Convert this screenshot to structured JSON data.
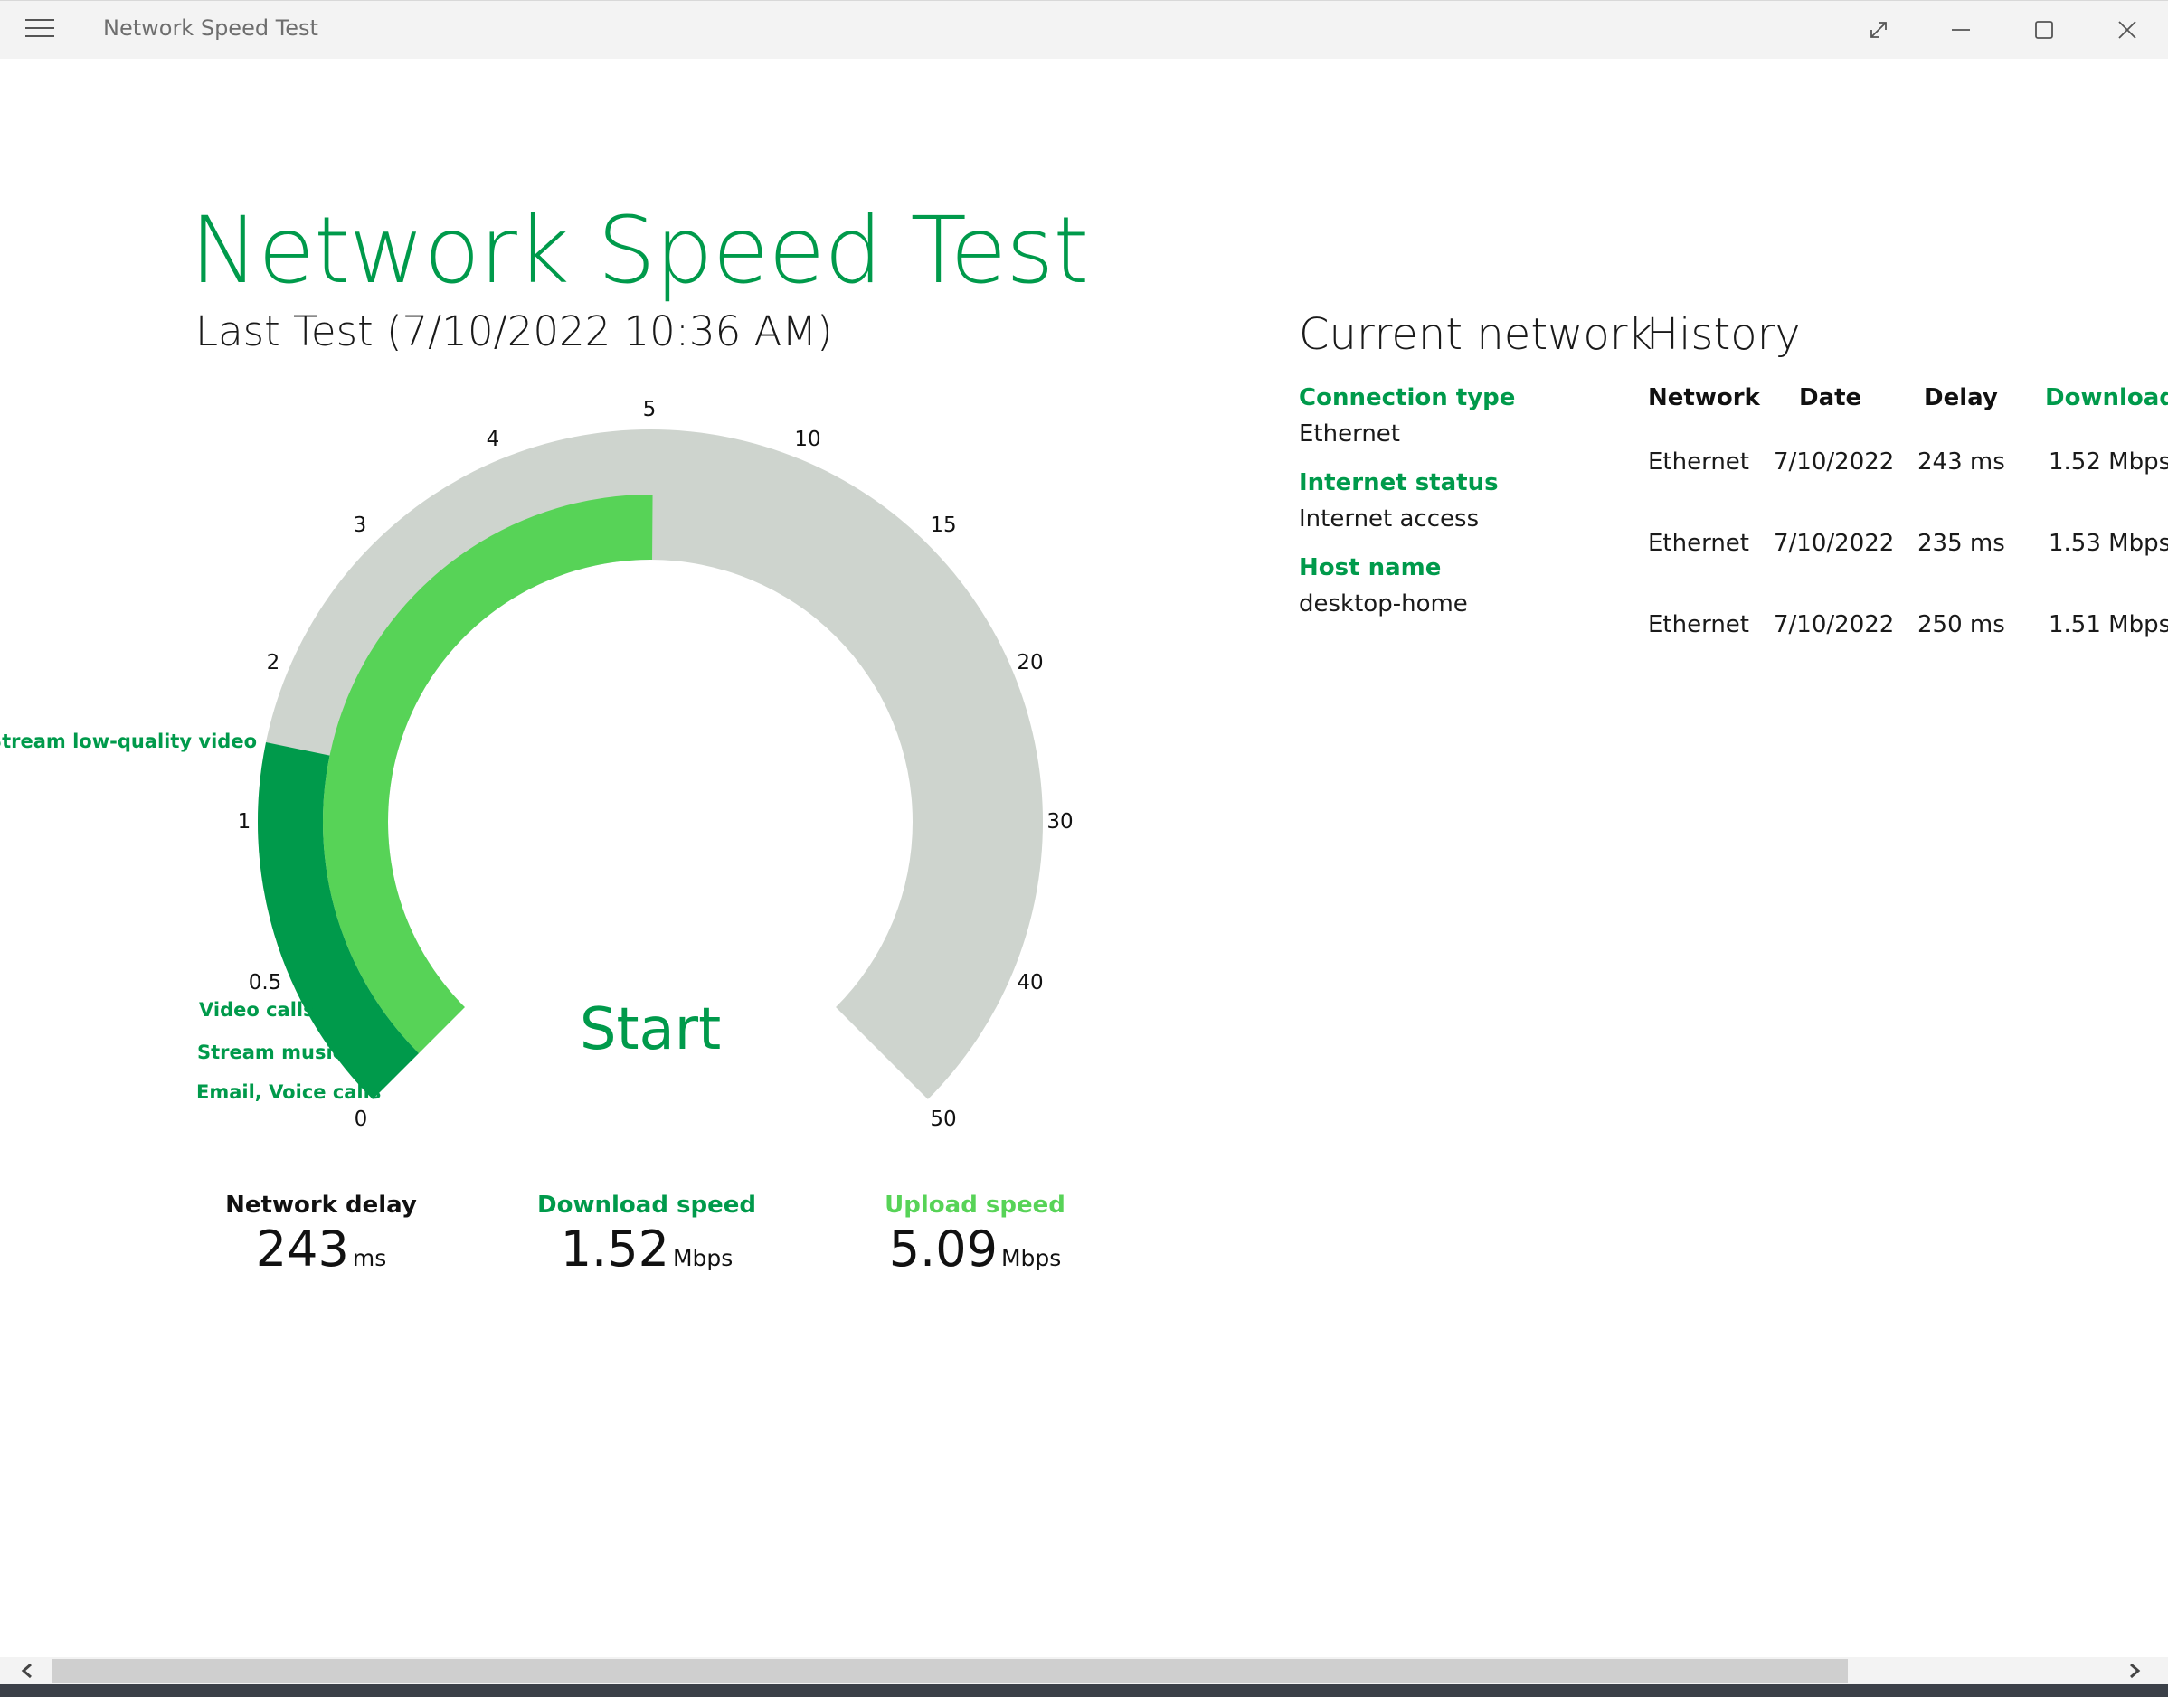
{
  "window": {
    "title": "Network Speed Test",
    "icons": [
      "hamburger-menu-icon",
      "compact-overlay-icon",
      "minimize-icon",
      "maximize-icon",
      "close-icon"
    ]
  },
  "colors": {
    "accent": "#009a4b",
    "upload": "#57d357",
    "track": "#ced4ce"
  },
  "header": {
    "title": "Network Speed Test",
    "last_test": "Last Test (7/10/2022 10:36 AM)"
  },
  "gauge": {
    "ticks": [
      "0",
      "0.5",
      "1",
      "2",
      "3",
      "4",
      "5",
      "10",
      "15",
      "20",
      "30",
      "40",
      "50"
    ],
    "usage_labels": [
      "Stream low-quality video",
      "Video calls",
      "Stream music",
      "Email, Voice calls"
    ],
    "start_label": "Start",
    "download_mbps": 1.52,
    "upload_mbps": 5.09
  },
  "stats": {
    "delay": {
      "label": "Network delay",
      "value": "243",
      "unit": "ms"
    },
    "download": {
      "label": "Download speed",
      "value": "1.52",
      "unit": "Mbps"
    },
    "upload": {
      "label": "Upload speed",
      "value": "5.09",
      "unit": "Mbps"
    }
  },
  "current_network": {
    "title": "Current network",
    "items": [
      {
        "label": "Connection type",
        "value": "Ethernet"
      },
      {
        "label": "Internet status",
        "value": "Internet access"
      },
      {
        "label": "Host name",
        "value": "desktop-home"
      }
    ]
  },
  "history": {
    "title": "History",
    "columns": [
      "Network",
      "Date",
      "Delay",
      "Download"
    ],
    "rows": [
      [
        "Ethernet",
        "7/10/2022",
        "243 ms",
        "1.52 Mbps"
      ],
      [
        "Ethernet",
        "7/10/2022",
        "235 ms",
        "1.53 Mbps"
      ],
      [
        "Ethernet",
        "7/10/2022",
        "250 ms",
        "1.51 Mbps"
      ]
    ]
  }
}
